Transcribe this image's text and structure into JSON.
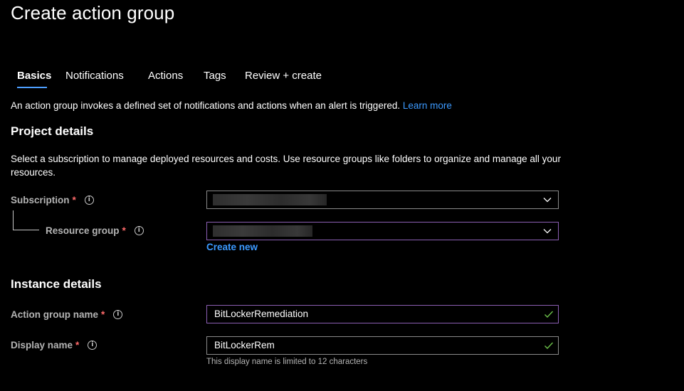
{
  "page": {
    "title": "Create action group"
  },
  "tabs": [
    {
      "label": "Basics",
      "active": true
    },
    {
      "label": "Notifications",
      "active": false
    },
    {
      "label": "Actions",
      "active": false
    },
    {
      "label": "Tags",
      "active": false
    },
    {
      "label": "Review + create",
      "active": false
    }
  ],
  "intro": {
    "text": "An action group invokes a defined set of notifications and actions when an alert is triggered.",
    "link": "Learn more"
  },
  "project": {
    "heading": "Project details",
    "description": "Select a subscription to manage deployed resources and costs. Use resource groups like folders to organize and manage all your resources.",
    "subscription_label": "Subscription",
    "resource_group_label": "Resource group",
    "create_new": "Create new"
  },
  "instance": {
    "heading": "Instance details",
    "action_group_name_label": "Action group name",
    "action_group_name_value": "BitLockerRemediation",
    "display_name_label": "Display name",
    "display_name_value": "BitLockerRem",
    "display_name_hint": "This display name is limited to 12 characters"
  },
  "common": {
    "required_mark": "*",
    "info_glyph": "i"
  },
  "icons": {
    "dropdown": "chevron-down-icon",
    "valid": "checkmark-icon",
    "info": "info-icon"
  },
  "colors": {
    "background": "#000000",
    "accent": "#3c9aff",
    "required": "#ff6a6a",
    "valid": "#6cc24a",
    "focus_border": "#8c5fb4"
  }
}
